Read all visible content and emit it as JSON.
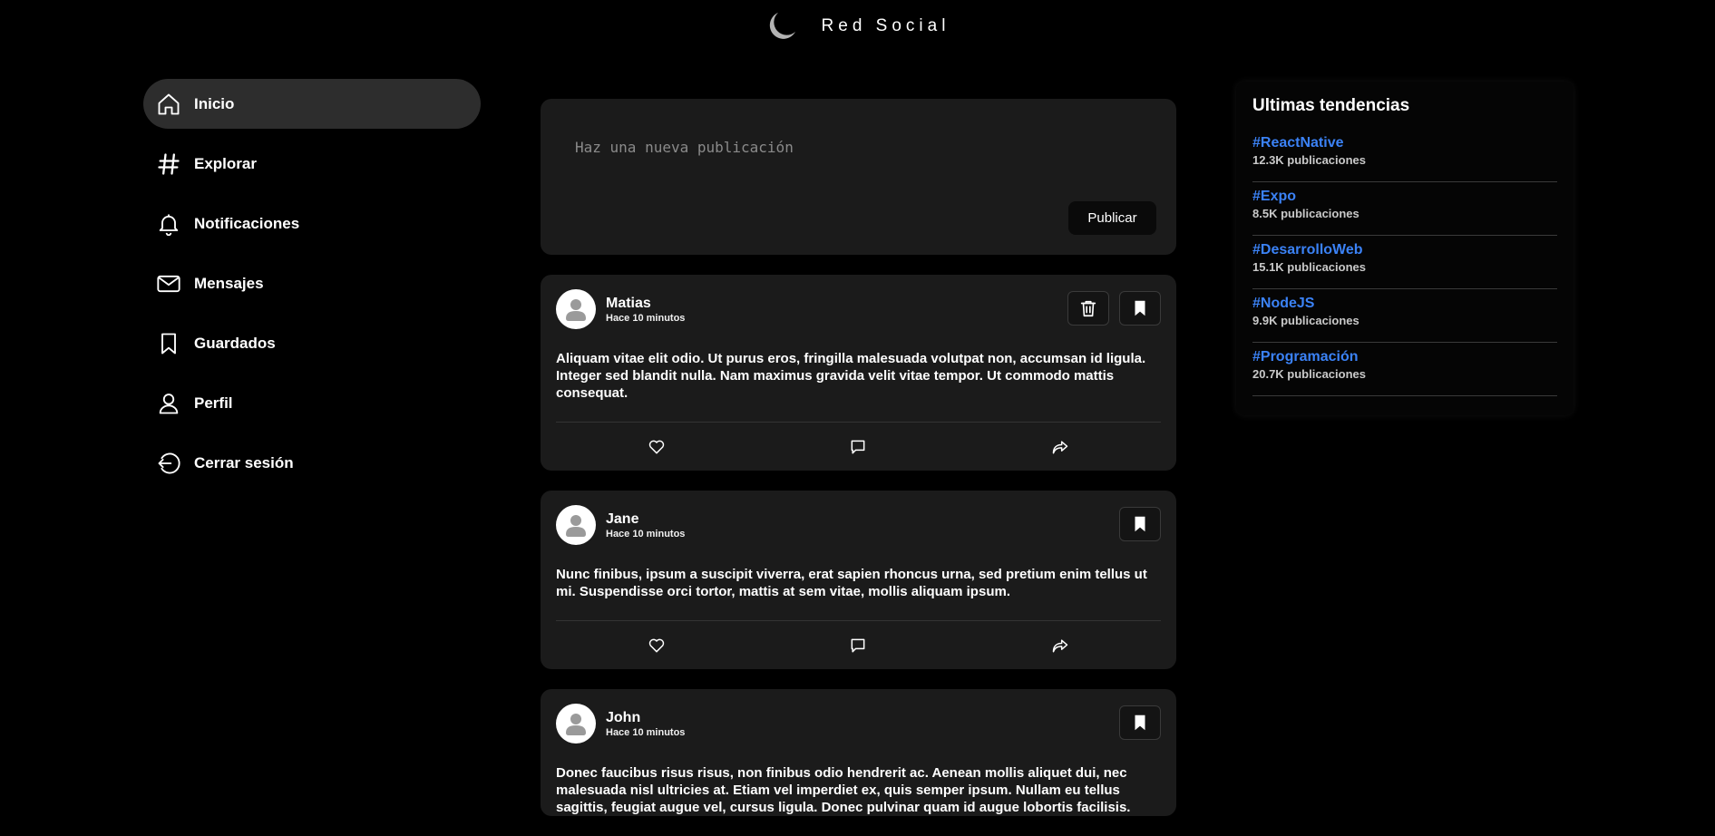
{
  "header": {
    "title": "Red Social",
    "icon": "moon-icon"
  },
  "sidebar": {
    "items": [
      {
        "label": "Inicio",
        "icon": "home-icon",
        "active": true
      },
      {
        "label": "Explorar",
        "icon": "hashtag-icon"
      },
      {
        "label": "Notificaciones",
        "icon": "bell-icon"
      },
      {
        "label": "Mensajes",
        "icon": "mail-icon"
      },
      {
        "label": "Guardados",
        "icon": "bookmark-icon"
      },
      {
        "label": "Perfil",
        "icon": "user-icon"
      },
      {
        "label": "Cerrar sesión",
        "icon": "logout-icon"
      }
    ]
  },
  "composer": {
    "placeholder": "Haz una nueva publicación",
    "value": "",
    "publish_label": "Publicar"
  },
  "posts": [
    {
      "author": "Matias",
      "time": "Hace 10 minutos",
      "body": "Aliquam vitae elit odio. Ut purus eros, fringilla malesuada volutpat non, accumsan id ligula. Integer sed blandit nulla. Nam maximus gravida velit vitae tempor. Ut commodo mattis consequat.",
      "has_delete": true
    },
    {
      "author": "Jane",
      "time": "Hace 10 minutos",
      "body": "Nunc finibus, ipsum a suscipit viverra, erat sapien rhoncus urna, sed pretium enim tellus ut mi. Suspendisse orci tortor, mattis at sem vitae, mollis aliquam ipsum.",
      "has_delete": false
    },
    {
      "author": "John",
      "time": "Hace 10 minutos",
      "body": "Donec faucibus risus risus, non finibus odio hendrerit ac. Aenean mollis aliquet dui, nec malesuada nisl ultricies at. Etiam vel imperdiet ex, quis semper ipsum. Nullam eu tellus sagittis, feugiat augue vel, cursus ligula. Donec pulvinar quam id augue lobortis facilisis.",
      "has_delete": false
    }
  ],
  "trends": {
    "title": "Ultimas tendencias",
    "items": [
      {
        "tag": "#ReactNative",
        "count": "12.3K publicaciones"
      },
      {
        "tag": "#Expo",
        "count": "8.5K publicaciones"
      },
      {
        "tag": "#DesarrolloWeb",
        "count": "15.1K publicaciones"
      },
      {
        "tag": "#NodeJS",
        "count": "9.9K publicaciones"
      },
      {
        "tag": "#Programación",
        "count": "20.7K publicaciones"
      }
    ]
  },
  "colors": {
    "background": "#000000",
    "card": "#1b1b1b",
    "accent": "#3b82f6",
    "active_nav": "#2d2d2d"
  }
}
